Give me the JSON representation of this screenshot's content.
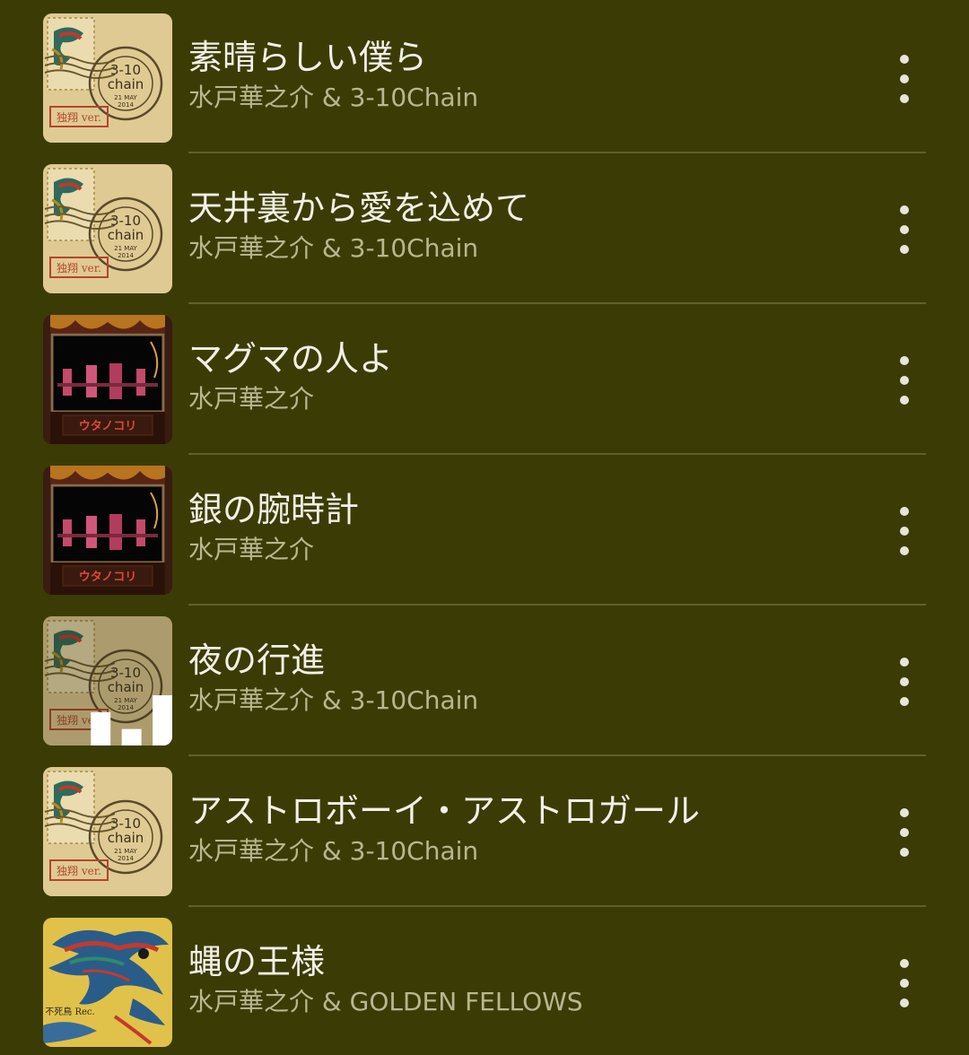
{
  "songs": [
    {
      "title": "素晴らしい僕ら",
      "artist": "水戸華之介 & 3-10Chain",
      "art": "stamp-art",
      "playing": false
    },
    {
      "title": "天井裏から愛を込めて",
      "artist": "水戸華之介 & 3-10Chain",
      "art": "stamp-art",
      "playing": false
    },
    {
      "title": "マグマの人よ",
      "artist": "水戸華之介",
      "art": "stage-art",
      "playing": false
    },
    {
      "title": "銀の腕時計",
      "artist": "水戸華之介",
      "art": "stage-art",
      "playing": false
    },
    {
      "title": "夜の行進",
      "artist": "水戸華之介 & 3-10Chain",
      "art": "stamp-art",
      "playing": true
    },
    {
      "title": "アストロボーイ・アストロガール",
      "artist": "水戸華之介 & 3-10Chain",
      "art": "stamp-art",
      "playing": false
    },
    {
      "title": "蝿の王様",
      "artist": "水戸華之介 & GOLDEN FELLOWS",
      "art": "phoenix-art",
      "playing": false
    }
  ],
  "art_labels": {
    "stamp_line1": "3-10",
    "stamp_line2": "chain",
    "stamp_line3": "21 MAY",
    "stamp_line4": "2014",
    "stamp_ver": "独翔 ver.",
    "stage_caption": "ウタノコリ",
    "phoenix_label": "不死鳥 Rec."
  },
  "colors": {
    "background": "#3b3c05",
    "title_text": "#f2f0e6",
    "subtitle_text": "#b8b78f",
    "divider": "#5f602e",
    "more_icon": "#e8e6d8"
  },
  "icons": {
    "more": "more-vertical-icon",
    "now_playing": "equalizer-bars-icon"
  }
}
